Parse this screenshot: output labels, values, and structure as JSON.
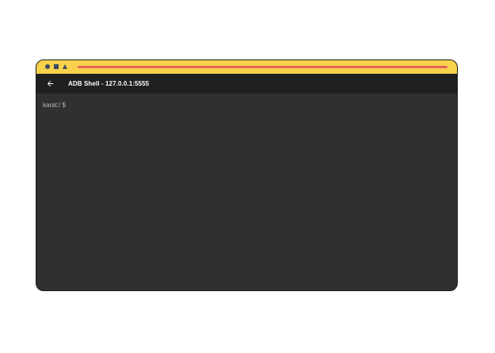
{
  "status_bar": {
    "icons": [
      "circle-icon",
      "square-icon",
      "triangle-icon"
    ],
    "color": "#f8d24a",
    "accent_line_color": "#e8665a"
  },
  "app_bar": {
    "back_icon": "arrow-left-icon",
    "title": "ADB Shell - 127.0.0.1:5555"
  },
  "terminal": {
    "prompt": "karat:/ $"
  }
}
